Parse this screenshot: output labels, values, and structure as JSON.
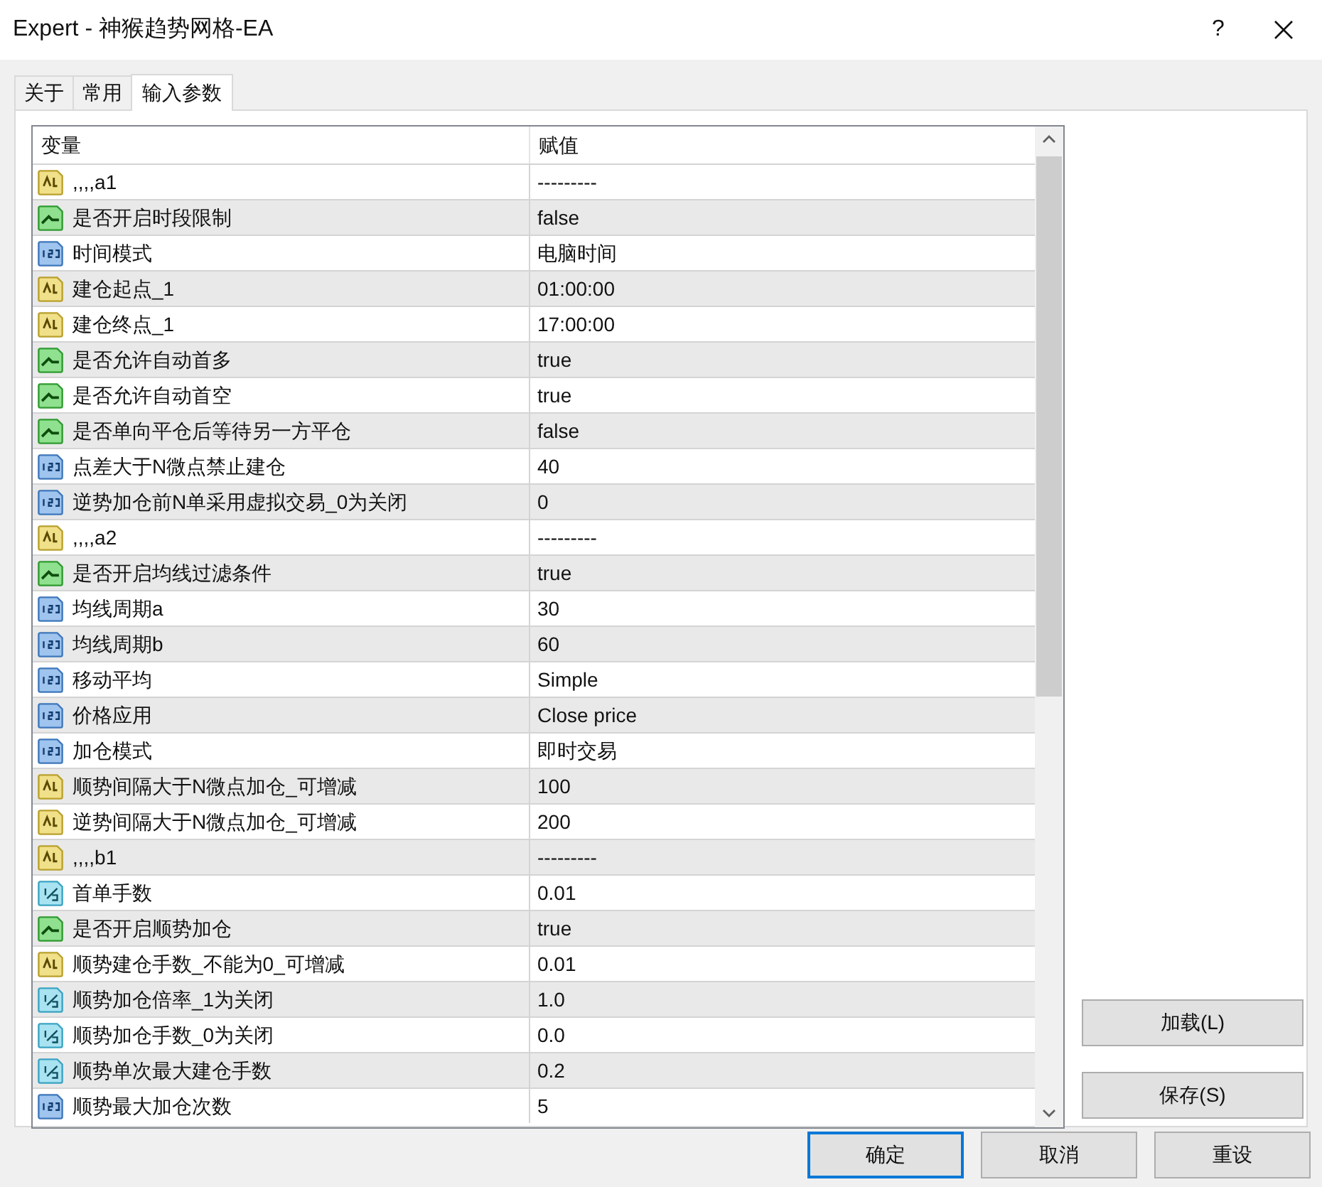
{
  "window": {
    "title": "Expert - 神猴趋势网格-EA",
    "help": "?"
  },
  "tabs": [
    {
      "label": "关于",
      "selected": false
    },
    {
      "label": "常用",
      "selected": false
    },
    {
      "label": "输入参数",
      "selected": true
    }
  ],
  "table": {
    "columns": [
      "变量",
      "赋值"
    ],
    "rows": [
      {
        "kind": "string",
        "name": ",,,,a1",
        "value": "---------"
      },
      {
        "kind": "bool",
        "name": "是否开启时段限制",
        "value": "false"
      },
      {
        "kind": "int",
        "name": "时间模式",
        "value": "电脑时间"
      },
      {
        "kind": "string",
        "name": "建仓起点_1",
        "value": "01:00:00"
      },
      {
        "kind": "string",
        "name": "建仓终点_1",
        "value": "17:00:00"
      },
      {
        "kind": "bool",
        "name": "是否允许自动首多",
        "value": "true"
      },
      {
        "kind": "bool",
        "name": "是否允许自动首空",
        "value": "true"
      },
      {
        "kind": "bool",
        "name": "是否单向平仓后等待另一方平仓",
        "value": "false"
      },
      {
        "kind": "int",
        "name": "点差大于N微点禁止建仓",
        "value": "40"
      },
      {
        "kind": "int",
        "name": "逆势加仓前N单采用虚拟交易_0为关闭",
        "value": "0"
      },
      {
        "kind": "string",
        "name": ",,,,a2",
        "value": "---------"
      },
      {
        "kind": "bool",
        "name": "是否开启均线过滤条件",
        "value": "true"
      },
      {
        "kind": "int",
        "name": "均线周期a",
        "value": "30"
      },
      {
        "kind": "int",
        "name": "均线周期b",
        "value": "60"
      },
      {
        "kind": "int",
        "name": "移动平均",
        "value": "Simple"
      },
      {
        "kind": "int",
        "name": "价格应用",
        "value": "Close price"
      },
      {
        "kind": "int",
        "name": "加仓模式",
        "value": "即时交易"
      },
      {
        "kind": "string",
        "name": "顺势间隔大于N微点加仓_可增减",
        "value": "100"
      },
      {
        "kind": "string",
        "name": "逆势间隔大于N微点加仓_可增减",
        "value": "200"
      },
      {
        "kind": "string",
        "name": ",,,,b1",
        "value": "---------"
      },
      {
        "kind": "double",
        "name": "首单手数",
        "value": "0.01"
      },
      {
        "kind": "bool",
        "name": "是否开启顺势加仓",
        "value": "true"
      },
      {
        "kind": "string",
        "name": "顺势建仓手数_不能为0_可增减",
        "value": "0.01"
      },
      {
        "kind": "double",
        "name": "顺势加仓倍率_1为关闭",
        "value": "1.0"
      },
      {
        "kind": "double",
        "name": "顺势加仓手数_0为关闭",
        "value": "0.0"
      },
      {
        "kind": "double",
        "name": "顺势单次最大建仓手数",
        "value": "0.2"
      },
      {
        "kind": "int",
        "name": "顺势最大加仓次数",
        "value": "5"
      }
    ]
  },
  "side_buttons": [
    "加载(L)",
    "保存(S)"
  ],
  "buttons": [
    {
      "label": "确定",
      "focused": true
    },
    {
      "label": "取消",
      "focused": false
    },
    {
      "label": "重设",
      "focused": false
    }
  ]
}
